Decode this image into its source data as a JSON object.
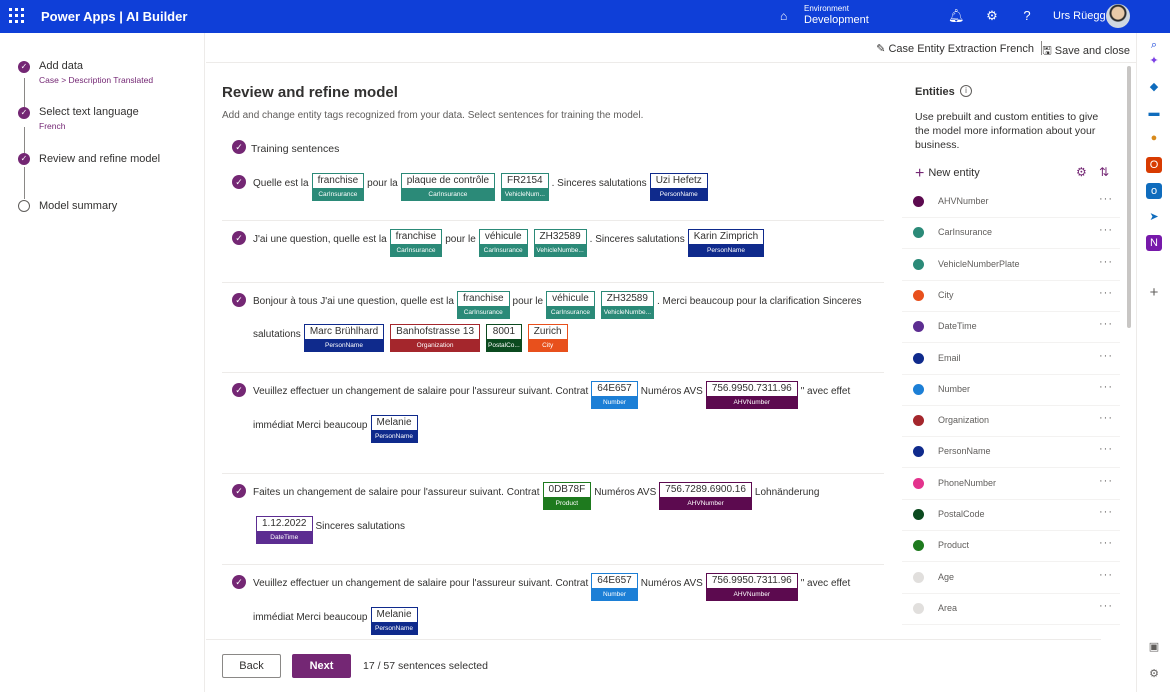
{
  "topbar": {
    "app_title": "Power Apps | AI Builder",
    "environment_label": "Environment",
    "environment_name": "Development",
    "user_name": "Urs Rüegg"
  },
  "stepper": {
    "steps": [
      {
        "title": "Add data",
        "subtitle": "Case > Description Translated",
        "state": "done"
      },
      {
        "title": "Select text language",
        "subtitle": "French",
        "state": "done"
      },
      {
        "title": "Review and refine model",
        "subtitle": "",
        "state": "current"
      },
      {
        "title": "Model summary",
        "subtitle": "",
        "state": "pending"
      }
    ]
  },
  "cmdbar": {
    "entity_name": "Case Entity Extraction French",
    "save_close": "Save and close"
  },
  "main": {
    "title": "Review and refine model",
    "description": "Add and change entity tags recognized from your data. Select sentences for training the model.",
    "training_label": "Training sentences"
  },
  "sentences": [
    {
      "lines": [
        [
          {
            "t": "Quelle est la"
          },
          {
            "w": "franchise",
            "tag": "CarInsurance",
            "c": "#2b8a78"
          },
          {
            "t": "pour la"
          },
          {
            "w": "plaque de contrôle",
            "tag": "CarInsurance",
            "c": "#2b8a78"
          },
          {
            "w": "FR2154",
            "tag": "VehicleNum...",
            "c": "#2b8a78"
          },
          {
            "t": ". Sinceres salutations"
          },
          {
            "w": "Uzi Hefetz",
            "tag": "PersonName",
            "c": "#0f2a8c"
          }
        ]
      ]
    },
    {
      "lines": [
        [
          {
            "t": "J'ai une question, quelle est la"
          },
          {
            "w": "franchise",
            "tag": "CarInsurance",
            "c": "#2b8a78"
          },
          {
            "t": "pour le"
          },
          {
            "w": "véhicule",
            "tag": "CarInsurance",
            "c": "#2b8a78"
          },
          {
            "w": "ZH32589",
            "tag": "VehicleNumbe...",
            "c": "#2b8a78"
          },
          {
            "t": ". Sinceres salutations"
          },
          {
            "w": "Karin Zimprich",
            "tag": "PersonName",
            "c": "#0f2a8c"
          }
        ]
      ]
    },
    {
      "lines": [
        [
          {
            "t": "Bonjour à tous J'ai une question, quelle est la"
          },
          {
            "w": "franchise",
            "tag": "CarInsurance",
            "c": "#2b8a78"
          },
          {
            "t": "pour le"
          },
          {
            "w": "véhicule",
            "tag": "CarInsurance",
            "c": "#2b8a78"
          },
          {
            "w": "ZH32589",
            "tag": "VehicleNumbe...",
            "c": "#2b8a78"
          },
          {
            "t": ". Merci beaucoup pour la clarification Sinceres"
          }
        ],
        [
          {
            "t": "salutations"
          },
          {
            "w": "Marc Brühlhard",
            "tag": "PersonName",
            "c": "#0f2a8c"
          },
          {
            "w": "Banhofstrasse 13",
            "tag": "Organization",
            "c": "#a4262c"
          },
          {
            "w": "8001",
            "tag": "PostalCo...",
            "c": "#0b4a1f"
          },
          {
            "w": "Zurich",
            "tag": "City",
            "c": "#e8501c"
          }
        ]
      ]
    },
    {
      "lines": [
        [
          {
            "t": "Veuillez effectuer un changement de salaire pour l'assureur suivant. Contrat"
          },
          {
            "w": "64E657",
            "tag": "Number",
            "c": "#1c7fd6"
          },
          {
            "t": "Numéros AVS"
          },
          {
            "w": "756.9950.7311.96",
            "tag": "AHVNumber",
            "c": "#5c0a4f"
          },
          {
            "t": "\" avec effet"
          }
        ],
        [
          {
            "t": "immédiat Merci beaucoup"
          },
          {
            "w": "Melanie",
            "tag": "PersonName",
            "c": "#0f2a8c"
          }
        ]
      ]
    },
    {
      "lines": [
        [
          {
            "t": "Faites un changement de salaire pour l'assureur suivant. Contrat"
          },
          {
            "w": "0DB78F",
            "tag": "Product",
            "c": "#1e7a1e"
          },
          {
            "t": "Numéros AVS"
          },
          {
            "w": "756.7289.6900.16",
            "tag": "AHVNumber",
            "c": "#5c0a4f"
          },
          {
            "t": "Lohnänderung"
          }
        ],
        [
          {
            "w": "1.12.2022",
            "tag": "DateTime",
            "c": "#5c2d91"
          },
          {
            "t": "Sinceres salutations"
          }
        ]
      ]
    },
    {
      "lines": [
        [
          {
            "t": "Veuillez effectuer un changement de salaire pour l'assureur suivant. Contrat"
          },
          {
            "w": "64E657",
            "tag": "Number",
            "c": "#1c7fd6"
          },
          {
            "t": "Numéros AVS"
          },
          {
            "w": "756.9950.7311.96",
            "tag": "AHVNumber",
            "c": "#5c0a4f"
          },
          {
            "t": "\" avec effet"
          }
        ],
        [
          {
            "t": "immédiat Merci beaucoup"
          },
          {
            "w": "Melanie",
            "tag": "PersonName",
            "c": "#0f2a8c"
          }
        ]
      ]
    }
  ],
  "footer": {
    "back_label": "Back",
    "next_label": "Next",
    "selection_count": "17 / 57 sentences selected"
  },
  "entities_panel": {
    "title": "Entities",
    "description": "Use prebuilt and custom entities to give the model more information about your business.",
    "new_entity_label": "New entity",
    "items": [
      {
        "name": "AHVNumber",
        "color": "#5c0a4f"
      },
      {
        "name": "CarInsurance",
        "color": "#2b8a78"
      },
      {
        "name": "VehicleNumberPlate",
        "color": "#2b8a78"
      },
      {
        "name": "City",
        "color": "#e8501c"
      },
      {
        "name": "DateTime",
        "color": "#5c2d91"
      },
      {
        "name": "Email",
        "color": "#0f2a8c"
      },
      {
        "name": "Number",
        "color": "#1c7fd6"
      },
      {
        "name": "Organization",
        "color": "#a4262c"
      },
      {
        "name": "PersonName",
        "color": "#0f2a8c"
      },
      {
        "name": "PhoneNumber",
        "color": "#e3338d"
      },
      {
        "name": "PostalCode",
        "color": "#0b4a1f"
      },
      {
        "name": "Product",
        "color": "#1e7a1e"
      },
      {
        "name": "Age",
        "color": "#e1dfdd"
      },
      {
        "name": "Area",
        "color": "#e1dfdd"
      }
    ]
  },
  "colors": {
    "brand_bar": "#0f3fd8",
    "accent": "#742774"
  }
}
